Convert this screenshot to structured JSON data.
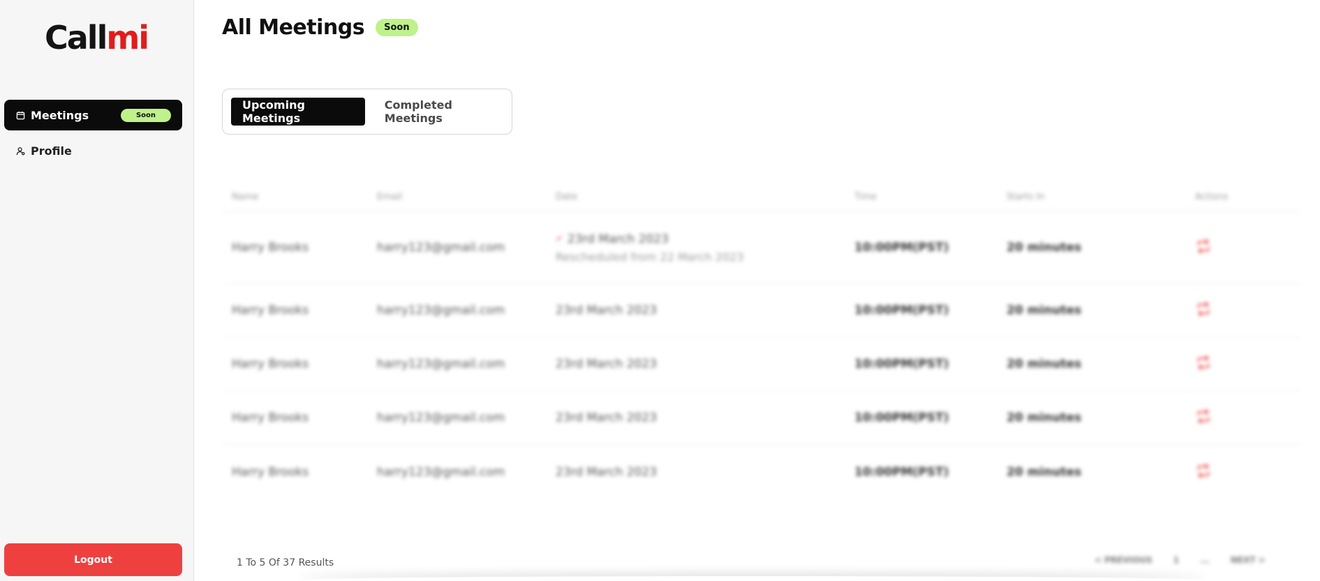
{
  "brand": {
    "logo_part1": "Call",
    "logo_part2": "mi"
  },
  "sidebar": {
    "items": [
      {
        "label": "Meetings",
        "icon": "calendar-icon",
        "badge": "Soon",
        "active": true
      },
      {
        "label": "Profile",
        "icon": "user-icon",
        "active": false
      }
    ],
    "logout_label": "Logout"
  },
  "header": {
    "title": "All Meetings",
    "badge": "Soon"
  },
  "tabs": [
    {
      "label": "Upcoming Meetings",
      "active": true
    },
    {
      "label": "Completed Meetings",
      "active": false
    }
  ],
  "table": {
    "columns": [
      "Name",
      "Email",
      "Date",
      "Time",
      "Starts In",
      "Actions"
    ],
    "rows": [
      {
        "name": "Harry Brooks",
        "email": "harry123@gmail.com",
        "date": "23rd March 2023",
        "note": "Rescheduled from 22 March 2023",
        "time": "10:00PM(PST)",
        "starts_in": "20 minutes",
        "action_icon": "reschedule-icon"
      },
      {
        "name": "Harry Brooks",
        "email": "harry123@gmail.com",
        "date": "23rd March 2023",
        "time": "10:00PM(PST)",
        "starts_in": "20 minutes",
        "action_icon": "reschedule-icon"
      },
      {
        "name": "Harry Brooks",
        "email": "harry123@gmail.com",
        "date": "23rd March 2023",
        "time": "10:00PM(PST)",
        "starts_in": "20 minutes",
        "action_icon": "reschedule-icon"
      },
      {
        "name": "Harry Brooks",
        "email": "harry123@gmail.com",
        "date": "23rd March 2023",
        "time": "10:00PM(PST)",
        "starts_in": "20 minutes",
        "action_icon": "reschedule-icon"
      },
      {
        "name": "Harry Brooks",
        "email": "harry123@gmail.com",
        "date": "23rd March 2023",
        "time": "10:00PM(PST)",
        "starts_in": "20 minutes",
        "action_icon": "reschedule-icon"
      }
    ]
  },
  "footer": {
    "results_text": "1 To 5 Of 37 Results",
    "pagination": {
      "previous": "< PREVIOUS",
      "page": "1",
      "ellipsis": "...",
      "next": "NEXT >"
    }
  },
  "colors": {
    "accent_red": "#ef4040",
    "badge_green": "#bff28a",
    "primary_dark": "#0b0b0b"
  }
}
